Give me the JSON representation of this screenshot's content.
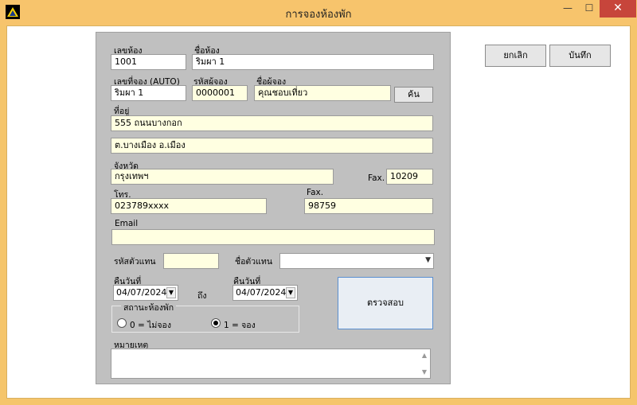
{
  "window": {
    "title": "การจองห้องพัก",
    "minimize_glyph": "—",
    "maximize_glyph": "☐",
    "close_glyph": "✕",
    "icon": "app-triangle-icon"
  },
  "toolbar": {
    "cancel_label": "ยกเลิก",
    "save_label": "บันทึก"
  },
  "form": {
    "room_no": {
      "label": "เลขห้อง",
      "value": "1001"
    },
    "room_name": {
      "label": "ชื่อห้อง",
      "value": "ริมผา 1"
    },
    "booking_no": {
      "label": "เลขที่จอง (AUTO)",
      "value": "ริมผา 1"
    },
    "booker_code": {
      "label": "รหัสผู้จอง",
      "value": "0000001"
    },
    "booker_name": {
      "label": "ชื่อผู้จอง",
      "value": "คุณชอบเที่ยว"
    },
    "search_label": "ค้น",
    "address": {
      "label": "ที่อยู่",
      "line1": "555 ถนนบางกอก",
      "line2": "ต.บางเมือง อ.เมือง"
    },
    "province": {
      "label": "จังหวัด",
      "value": "กรุงเทพฯ"
    },
    "postcode": {
      "label": "Fax.",
      "value": "10209"
    },
    "phone": {
      "label": "โทร.",
      "value": "023789xxxx"
    },
    "fax": {
      "label": "Fax.",
      "value": "98759"
    },
    "email": {
      "label": "Email",
      "value": ""
    },
    "agent_code": {
      "label": "รหัสตัวแทน",
      "value": ""
    },
    "agent_name": {
      "label": "ชื่อตัวแทน",
      "value": ""
    },
    "checkin": {
      "label": "คืนวันที่",
      "value": "04/07/2024"
    },
    "to_label": "ถึง",
    "checkout": {
      "label": "คืนวันที่",
      "value": "04/07/2024"
    },
    "check_button": "ตรวจสอบ",
    "room_status": {
      "label": "สถานะห้องพัก",
      "options": [
        {
          "label": "0 = ไม่จอง",
          "selected": false
        },
        {
          "label": "1 = จอง",
          "selected": true
        }
      ]
    },
    "note": {
      "label": "หมายเหตุ",
      "value": ""
    }
  }
}
